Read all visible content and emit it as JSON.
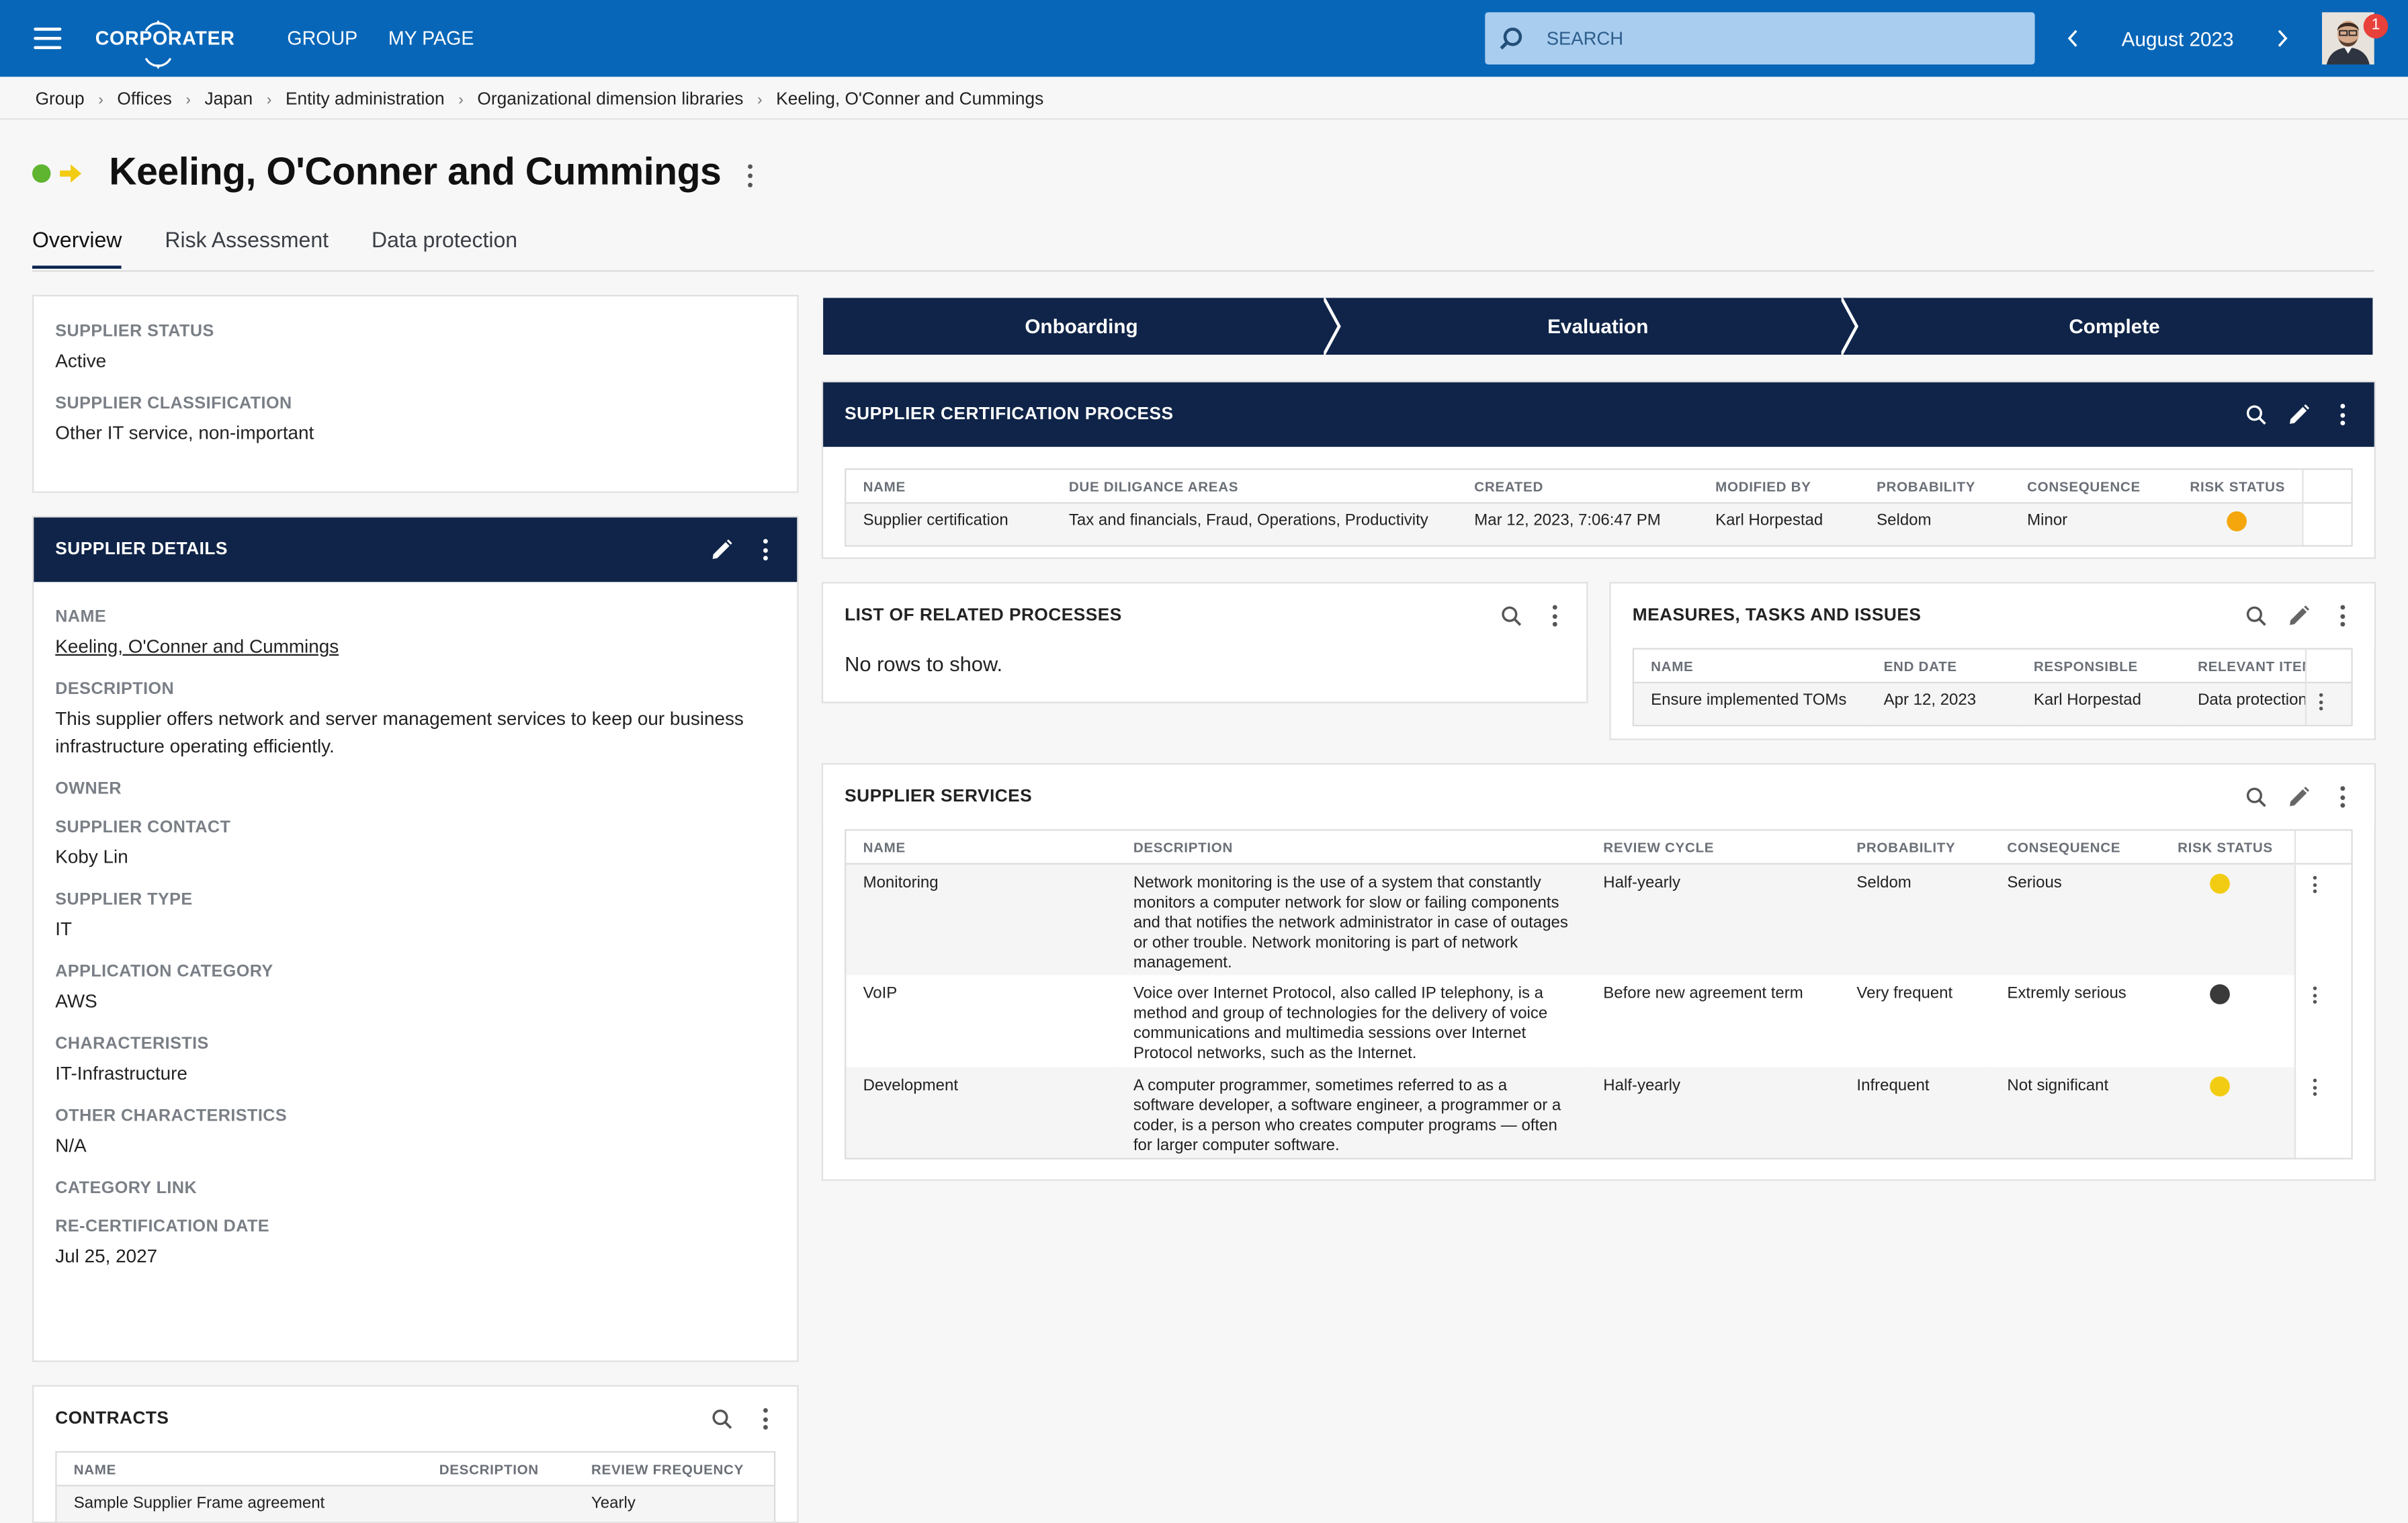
{
  "topbar": {
    "brand": "CORPORATER",
    "nav": [
      "GROUP",
      "MY PAGE"
    ],
    "search_placeholder": "SEARCH",
    "period": "August 2023",
    "notifications": "1"
  },
  "breadcrumb": [
    "Group",
    "Offices",
    "Japan",
    "Entity administration",
    "Organizational dimension libraries",
    "Keeling, O'Conner and Cummings"
  ],
  "page": {
    "title": "Keeling, O'Conner and Cummings",
    "tabs": [
      "Overview",
      "Risk Assessment",
      "Data protection"
    ]
  },
  "status_card": {
    "fields": [
      {
        "label": "SUPPLIER STATUS",
        "value": "Active"
      },
      {
        "label": "SUPPLIER CLASSIFICATION",
        "value": "Other IT service, non-important"
      }
    ]
  },
  "supplier_details": {
    "title": "SUPPLIER DETAILS",
    "name_label": "NAME",
    "name_value": "Keeling, O'Conner and Cummings",
    "fields": [
      {
        "label": "DESCRIPTION",
        "value": "This supplier offers network and server management services to keep our business infrastructure operating efficiently."
      },
      {
        "label": "OWNER",
        "value": ""
      },
      {
        "label": "SUPPLIER CONTACT",
        "value": "Koby Lin"
      },
      {
        "label": "SUPPLIER TYPE",
        "value": "IT"
      },
      {
        "label": "APPLICATION CATEGORY",
        "value": "AWS"
      },
      {
        "label": "CHARACTERISTIS",
        "value": "IT-Infrastructure"
      },
      {
        "label": "OTHER CHARACTERISTICS",
        "value": "N/A"
      },
      {
        "label": "CATEGORY LINK",
        "value": ""
      },
      {
        "label": "RE-CERTIFICATION DATE",
        "value": "Jul 25, 2027"
      }
    ]
  },
  "contracts": {
    "title": "CONTRACTS",
    "columns": [
      "NAME",
      "DESCRIPTION",
      "REVIEW FREQUENCY"
    ],
    "rows": [
      [
        "Sample Supplier Frame agreement",
        "",
        "Yearly"
      ]
    ]
  },
  "stepper": [
    "Onboarding",
    "Evaluation",
    "Complete"
  ],
  "certification": {
    "title": "SUPPLIER CERTIFICATION PROCESS",
    "columns": [
      "NAME",
      "DUE DILIGANCE AREAS",
      "CREATED",
      "MODIFIED BY",
      "PROBABILITY",
      "CONSEQUENCE",
      "RISK STATUS"
    ],
    "rows": [
      {
        "name": "Supplier certification",
        "areas": "Tax and financials, Fraud, Operations, Productivity",
        "created": "Mar 12, 2023, 7:06:47 PM",
        "modified_by": "Karl Horpestad",
        "probability": "Seldom",
        "consequence": "Minor",
        "status_color": "#f4a60c"
      }
    ]
  },
  "related_processes": {
    "title": "LIST OF RELATED PROCESSES",
    "empty": "No rows to show."
  },
  "measures": {
    "title": "MEASURES, TASKS AND ISSUES",
    "columns": [
      "NAME",
      "END DATE",
      "RESPONSIBLE",
      "RELEVANT ITEMS"
    ],
    "rows": [
      [
        "Ensure implemented TOMs",
        "Apr 12, 2023",
        "Karl Horpestad",
        "Data protection c"
      ]
    ]
  },
  "services": {
    "title": "SUPPLIER SERVICES",
    "columns": [
      "NAME",
      "DESCRIPTION",
      "REVIEW CYCLE",
      "PROBABILITY",
      "CONSEQUENCE",
      "RISK STATUS"
    ],
    "rows": [
      {
        "name": "Monitoring",
        "description": "Network monitoring is the use of a system that constantly monitors a computer network for slow or failing components and that notifies the network administrator in case of outages or other trouble. Network monitoring is part of network management.",
        "review": "Half-yearly",
        "probability": "Seldom",
        "consequence": "Serious",
        "status_color": "#f2cc13"
      },
      {
        "name": "VoIP",
        "description": "Voice over Internet Protocol, also called IP telephony, is a method and group of technologies for the delivery of voice communications and multimedia sessions over Internet Protocol networks, such as the Internet.",
        "review": "Before new agreement term",
        "probability": "Very frequent",
        "consequence": "Extremly serious",
        "status_color": "#3a3a3a"
      },
      {
        "name": "Development",
        "description": "A computer programmer, sometimes referred to as a software developer, a software engineer, a programmer or a coder, is a person who creates computer programs — often for larger computer software.",
        "review": "Half-yearly",
        "probability": "Infrequent",
        "consequence": "Not significant",
        "status_color": "#f2cc13"
      }
    ]
  },
  "colors": {
    "topbar": "#0766b8",
    "navy": "#0f2448",
    "status_active": "#5fb430",
    "arrow": "#f2cc13"
  }
}
